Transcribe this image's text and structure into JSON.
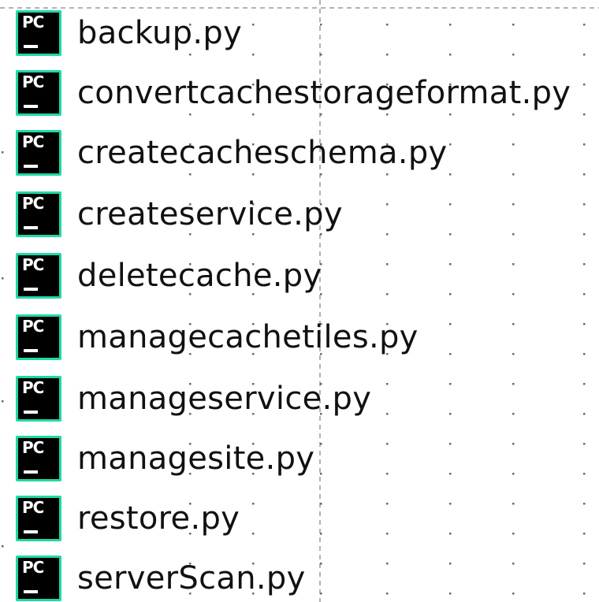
{
  "files": [
    {
      "name": "backup.py",
      "icon": "pycharm-icon",
      "icon_label": "PC"
    },
    {
      "name": "convertcachestorageformat.py",
      "icon": "pycharm-icon",
      "icon_label": "PC"
    },
    {
      "name": "createcacheschema.py",
      "icon": "pycharm-icon",
      "icon_label": "PC"
    },
    {
      "name": "createservice.py",
      "icon": "pycharm-icon",
      "icon_label": "PC"
    },
    {
      "name": "deletecache.py",
      "icon": "pycharm-icon",
      "icon_label": "PC"
    },
    {
      "name": "managecachetiles.py",
      "icon": "pycharm-icon",
      "icon_label": "PC"
    },
    {
      "name": "manageservice.py",
      "icon": "pycharm-icon",
      "icon_label": "PC"
    },
    {
      "name": "managesite.py",
      "icon": "pycharm-icon",
      "icon_label": "PC"
    },
    {
      "name": "restore.py",
      "icon": "pycharm-icon",
      "icon_label": "PC"
    },
    {
      "name": "serverScan.py",
      "icon": "pycharm-icon",
      "icon_label": "PC"
    }
  ],
  "colors": {
    "icon_border": "#1fd9a5",
    "icon_background": "#000000",
    "text": "#111111",
    "guide_lines": "#9a9a9a"
  }
}
